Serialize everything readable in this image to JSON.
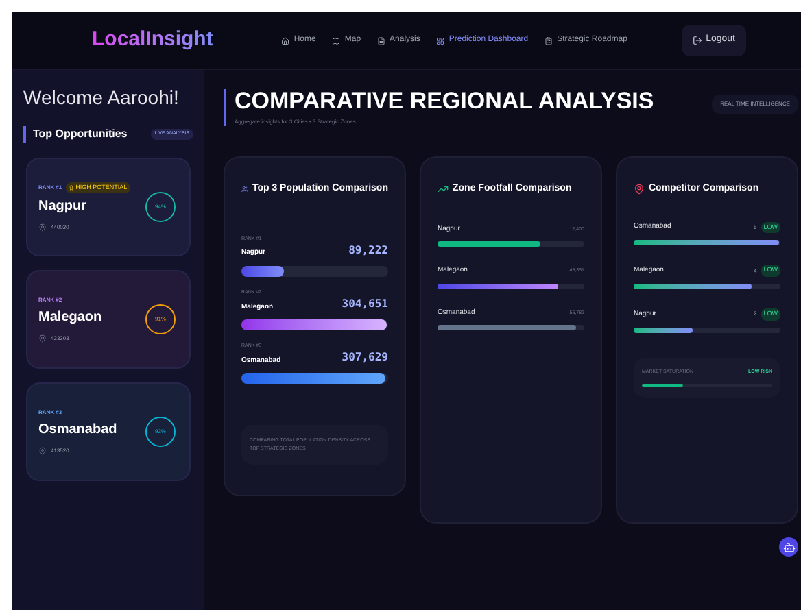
{
  "brand": "LocalInsight",
  "nav": [
    {
      "label": "Home",
      "selected": false
    },
    {
      "label": "Map",
      "selected": false
    },
    {
      "label": "Analysis",
      "selected": false
    },
    {
      "label": "Prediction Dashboard",
      "selected": true
    },
    {
      "label": "Strategic Roadmap",
      "selected": false
    }
  ],
  "logout": "Logout",
  "welcome": "Welcome Aaroohi!",
  "opportunities_title": "Top Opportunities",
  "live_badge": "LIVE ANALYSIS",
  "opportunities": [
    {
      "rank": "RANK #1",
      "tag": "HIGH POTENTIAL",
      "city": "Nagpur",
      "pincode": "440020",
      "score": "94%",
      "color": "#14b8a6"
    },
    {
      "rank": "RANK #2",
      "city": "Malegaon",
      "pincode": "423203",
      "score": "91%",
      "color": "#f59e0b"
    },
    {
      "rank": "RANK #3",
      "city": "Osmanabad",
      "pincode": "413520",
      "score": "92%",
      "color": "#06b6d4"
    }
  ],
  "title": "COMPARATIVE REGIONAL ANALYSIS",
  "subtitle": "Aggregate insights for 3 Cities • 3 Strategic Zones",
  "realtime": "REAL TIME INTELLIGENCE",
  "population": {
    "title": "Top 3 Population Comparison",
    "rows": [
      {
        "rank": "RANK #1",
        "city": "Nagpur",
        "value": "89,222",
        "level": 0.29
      },
      {
        "rank": "RANK #2",
        "city": "Malegaon",
        "value": "304,651",
        "level": 0.99
      },
      {
        "rank": "RANK #3",
        "city": "Osmanabad",
        "value": "307,629",
        "level": 0.98
      }
    ],
    "note": "COMPARING TOTAL POPULATION DENSITY ACROSS TOP STRATEGIC ZONES"
  },
  "footfall": {
    "title": "Zone Footfall Comparison",
    "rows": [
      {
        "city": "Nagpur",
        "value": "12,400",
        "level": 0.7
      },
      {
        "city": "Malegaon",
        "value": "45,351",
        "level": 0.82
      },
      {
        "city": "Osmanabad",
        "value": "56,782",
        "level": 0.94
      }
    ]
  },
  "competitors": {
    "title": "Competitor Comparison",
    "rows": [
      {
        "city": "Osmanabad",
        "count": "5",
        "badge": "LOW",
        "level": 0.99
      },
      {
        "city": "Malegaon",
        "count": "4",
        "badge": "LOW",
        "level": 0.8
      },
      {
        "city": "Nagpur",
        "count": "2",
        "badge": "LOW",
        "level": 0.4
      }
    ],
    "saturation": {
      "label": "MARKET SATURATION",
      "value": "LOW RISK",
      "level": 0.32
    }
  }
}
